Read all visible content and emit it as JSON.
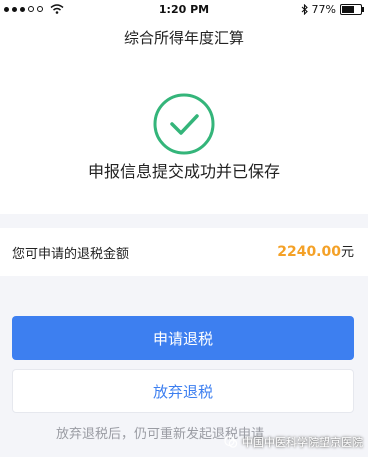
{
  "status_bar": {
    "time": "1:20 PM",
    "battery_percent": "77%",
    "battery_level": 0.77,
    "icons": [
      "signal-dots-icon",
      "wifi-icon",
      "bluetooth-icon",
      "battery-icon"
    ]
  },
  "nav": {
    "title": "综合所得年度汇算"
  },
  "success": {
    "icon": "check-circle-icon",
    "message": "申报信息提交成功并已保存"
  },
  "refund": {
    "label": "您可申请的退税金额",
    "amount": "2240.00",
    "unit": "元"
  },
  "actions": {
    "apply_label": "申请退税",
    "abandon_label": "放弃退税"
  },
  "footer": {
    "note": "放弃退税后，仍可重新发起退税申请"
  },
  "watermark": {
    "text": "中国中医科学院望京医院"
  },
  "colors": {
    "accent": "#3d7ff0",
    "success": "#34b57a",
    "amount": "#f4a127",
    "background": "#f4f5f9"
  }
}
